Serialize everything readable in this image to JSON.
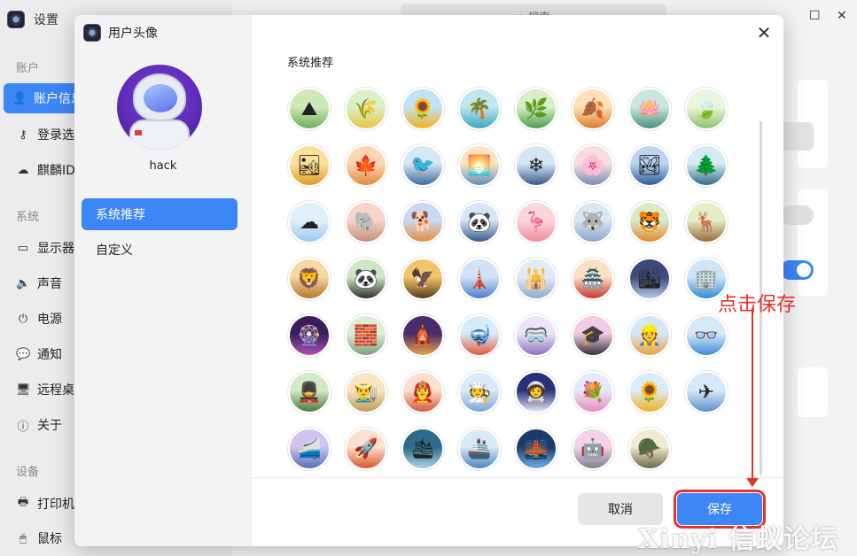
{
  "settings": {
    "title": "设置",
    "search_placeholder": "搜索",
    "sections": [
      "账户",
      "系统",
      "设备"
    ],
    "items": [
      {
        "label": "账户信息",
        "icon": "user-icon",
        "active": true
      },
      {
        "label": "登录选项",
        "icon": "key-icon"
      },
      {
        "label": "麒麟ID",
        "icon": "cloud-icon"
      },
      {
        "label": "显示器",
        "icon": "monitor-icon"
      },
      {
        "label": "声音",
        "icon": "speaker-icon"
      },
      {
        "label": "电源",
        "icon": "power-icon"
      },
      {
        "label": "通知",
        "icon": "bell-icon"
      },
      {
        "label": "远程桌面",
        "icon": "remote-desktop-icon"
      },
      {
        "label": "关于",
        "icon": "info-icon"
      },
      {
        "label": "打印机",
        "icon": "printer-icon"
      },
      {
        "label": "鼠标",
        "icon": "mouse-icon"
      }
    ]
  },
  "dialog": {
    "title": "用户头像",
    "username": "hack",
    "nav": [
      {
        "label": "系统推荐",
        "active": true
      },
      {
        "label": "自定义"
      }
    ],
    "section_label": "系统推荐",
    "cancel_label": "取消",
    "save_label": "保存",
    "accent": "#3d86f5"
  },
  "avatars": [
    {
      "name": "green-hills",
      "c1": "#cfe8b8",
      "c2": "#6fae58",
      "g": "⛰"
    },
    {
      "name": "yellow-field",
      "c1": "#d9f0c8",
      "c2": "#e9c640",
      "g": "🌾"
    },
    {
      "name": "sunflowers",
      "c1": "#bfe3f7",
      "c2": "#f2b31c",
      "g": "🌻"
    },
    {
      "name": "palm-beach",
      "c1": "#bfe7ef",
      "c2": "#3aa6b9",
      "g": "🌴"
    },
    {
      "name": "rice-terrace",
      "c1": "#d6efc9",
      "c2": "#4e9c4a",
      "g": "🌿"
    },
    {
      "name": "autumn-tree",
      "c1": "#fbe3b7",
      "c2": "#e07b2a",
      "g": "🍂"
    },
    {
      "name": "lotus-pond",
      "c1": "#c7e7df",
      "c2": "#4b8f7a",
      "g": "🪷"
    },
    {
      "name": "lotus-leaf",
      "c1": "#eaf5dd",
      "c2": "#8ec06a",
      "g": "🍃"
    },
    {
      "name": "desert-dunes",
      "c1": "#fbe09a",
      "c2": "#e39a26",
      "g": "🏜"
    },
    {
      "name": "autumn-river",
      "c1": "#fbd8b3",
      "c2": "#e6883a",
      "g": "🍁"
    },
    {
      "name": "magpies-branch",
      "c1": "#d6e7f5",
      "c2": "#3d6c9c",
      "g": "🐦"
    },
    {
      "name": "sunset-lake",
      "c1": "#fbe4bf",
      "c2": "#5f8fbf",
      "g": "🌅"
    },
    {
      "name": "snowy-river",
      "c1": "#d6e5f3",
      "c2": "#375a8a",
      "g": "❄"
    },
    {
      "name": "plum-blossom",
      "c1": "#f6dde0",
      "c2": "#7a8fb0",
      "g": "🌸"
    },
    {
      "name": "blue-lake",
      "c1": "#bcd4ee",
      "c2": "#2c5d9a",
      "g": "🏞"
    },
    {
      "name": "winter-lake",
      "c1": "#d5ebf3",
      "c2": "#2f6f8f",
      "g": "🌲"
    },
    {
      "name": "clouds-sky",
      "c1": "#e0f0fb",
      "c2": "#9cc9ea",
      "g": "☁"
    },
    {
      "name": "elephant",
      "c1": "#f5d5c8",
      "c2": "#c38d7a",
      "g": "🐘"
    },
    {
      "name": "shiba-dog",
      "c1": "#c7d9f5",
      "c2": "#e48d3b",
      "g": "🐕"
    },
    {
      "name": "panda-suit",
      "c1": "#d4e6f8",
      "c2": "#3a5a8a",
      "g": "🐼"
    },
    {
      "name": "flamingo",
      "c1": "#fbd7db",
      "c2": "#ee8b9a",
      "g": "🦩"
    },
    {
      "name": "white-wolf",
      "c1": "#d9e6f6",
      "c2": "#8aa6cf",
      "g": "🐺"
    },
    {
      "name": "tiger",
      "c1": "#d8ebc9",
      "c2": "#e08a2c",
      "g": "🐯"
    },
    {
      "name": "deer",
      "c1": "#e4efc6",
      "c2": "#9a6a3a",
      "g": "🦌"
    },
    {
      "name": "lion",
      "c1": "#f4d9a0",
      "c2": "#b5742a",
      "g": "🦁"
    },
    {
      "name": "panda-bamboo",
      "c1": "#cfe8c3",
      "c2": "#2f2f2f",
      "g": "🐼"
    },
    {
      "name": "eagle",
      "c1": "#f2c56a",
      "c2": "#5a3a1a",
      "g": "🦅"
    },
    {
      "name": "tv-tower",
      "c1": "#d2e3f6",
      "c2": "#4d7ecb",
      "g": "🗼"
    },
    {
      "name": "mosque",
      "c1": "#e0ecf7",
      "c2": "#8ea8c7",
      "g": "🕌"
    },
    {
      "name": "tiananmen",
      "c1": "#fbe0c5",
      "c2": "#c8362b",
      "g": "🏯"
    },
    {
      "name": "city-skyline",
      "c1": "#3c4a7a",
      "c2": "#b8c8ea",
      "g": "🏙"
    },
    {
      "name": "skyscrapers",
      "c1": "#cfe6f8",
      "c2": "#2c8ad6",
      "g": "🏢"
    },
    {
      "name": "ferris-wheel",
      "c1": "#3a1f5c",
      "c2": "#b04fb0",
      "g": "🎡"
    },
    {
      "name": "great-wall",
      "c1": "#d9eed7",
      "c2": "#7f9f7a",
      "g": "🧱"
    },
    {
      "name": "pagoda",
      "c1": "#4a2b6b",
      "c2": "#e8a24a",
      "g": "🛕"
    },
    {
      "name": "diver",
      "c1": "#d6ecf8",
      "c2": "#e5583b",
      "g": "🤿"
    },
    {
      "name": "vr-player",
      "c1": "#ece4f6",
      "c2": "#8f6fc0",
      "g": "🥽"
    },
    {
      "name": "graduate",
      "c1": "#f4cbe5",
      "c2": "#2f2f3a",
      "g": "🎓"
    },
    {
      "name": "worker-helmet",
      "c1": "#d7e6f6",
      "c2": "#e9a33a",
      "g": "👷"
    },
    {
      "name": "glasses-man",
      "c1": "#d6e9f7",
      "c2": "#3f8ad9",
      "g": "👓"
    },
    {
      "name": "soldier",
      "c1": "#d4eac7",
      "c2": "#4c7a3c",
      "g": "💂"
    },
    {
      "name": "farmer-hat",
      "c1": "#f6e6c5",
      "c2": "#c19a5c",
      "g": "👨‍🌾"
    },
    {
      "name": "firefighter",
      "c1": "#fbe0cf",
      "c2": "#d35a3a",
      "g": "🧑‍🚒"
    },
    {
      "name": "chef",
      "c1": "#dbeaf7",
      "c2": "#7aa6d3",
      "g": "🧑‍🍳"
    },
    {
      "name": "astronaut",
      "c1": "#2a2f7a",
      "c2": "#e0e6f5",
      "g": "🧑‍🚀"
    },
    {
      "name": "flower-pot",
      "c1": "#e6e9fb",
      "c2": "#e98bc0",
      "g": "💐"
    },
    {
      "name": "sunflower-pot",
      "c1": "#d9ecf7",
      "c2": "#f2b11c",
      "g": "🌻"
    },
    {
      "name": "fighter-jet",
      "c1": "#d7e8f8",
      "c2": "#5b8fc9",
      "g": "✈"
    },
    {
      "name": "bullet-train",
      "c1": "#cfc3ef",
      "c2": "#5a6fb8",
      "g": "🚄"
    },
    {
      "name": "rocket-launch",
      "c1": "#fbe1d0",
      "c2": "#d8562f",
      "g": "🚀"
    },
    {
      "name": "submarine",
      "c1": "#2c6b8a",
      "c2": "#a9d4e6",
      "g": "🛳"
    },
    {
      "name": "aircraft-carrier",
      "c1": "#d7eaf8",
      "c2": "#4f86c0",
      "g": "🚢"
    },
    {
      "name": "bridge-night",
      "c1": "#1f3a6a",
      "c2": "#6fb0e8",
      "g": "🌉"
    },
    {
      "name": "robot-face",
      "c1": "#f4d3e9",
      "c2": "#7f7f8f",
      "g": "🤖"
    },
    {
      "name": "tank",
      "c1": "#f2ead2",
      "c2": "#6a6a4a",
      "g": "🪖"
    }
  ],
  "annotation": {
    "text": "点击保存",
    "color": "#e63028"
  },
  "watermark": "Xinyi 信蚁论坛"
}
